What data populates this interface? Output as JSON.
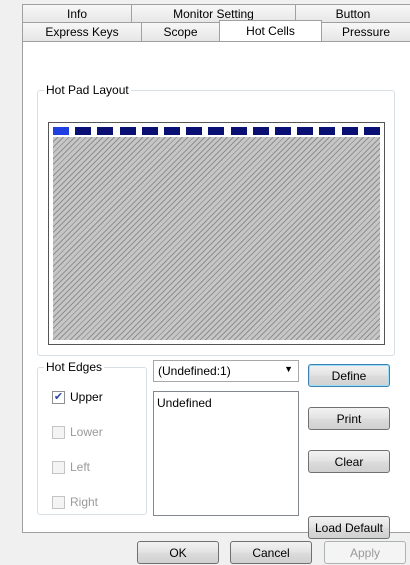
{
  "tabs": {
    "row1": [
      {
        "label": "Info"
      },
      {
        "label": "Monitor Setting"
      },
      {
        "label": "Button"
      }
    ],
    "row2": [
      {
        "label": "Express Keys"
      },
      {
        "label": "Scope"
      },
      {
        "label": "Hot Cells"
      },
      {
        "label": "Pressure"
      }
    ],
    "active": "Hot Cells"
  },
  "hot_pad_layout": {
    "legend": "Hot Pad Layout",
    "cell_count": 15,
    "selected_cell": 1
  },
  "hot_edges": {
    "legend": "Hot Edges",
    "options": [
      {
        "label": "Upper",
        "checked": true,
        "enabled": true
      },
      {
        "label": "Lower",
        "checked": false,
        "enabled": false
      },
      {
        "label": "Left",
        "checked": false,
        "enabled": false
      },
      {
        "label": "Right",
        "checked": false,
        "enabled": false
      }
    ]
  },
  "cell_dropdown": {
    "selected": "(Undefined:1)"
  },
  "function_list": {
    "items": [
      "Undefined"
    ]
  },
  "side_buttons": {
    "define": "Define",
    "print": "Print",
    "clear": "Clear",
    "load_default": "Load Default"
  },
  "dialog_buttons": {
    "ok": "OK",
    "cancel": "Cancel",
    "apply": "Apply"
  },
  "colors": {
    "cell": "#0a0f73",
    "cell_selected": "#1f3fe0",
    "hatch": "#c6c6c6"
  }
}
